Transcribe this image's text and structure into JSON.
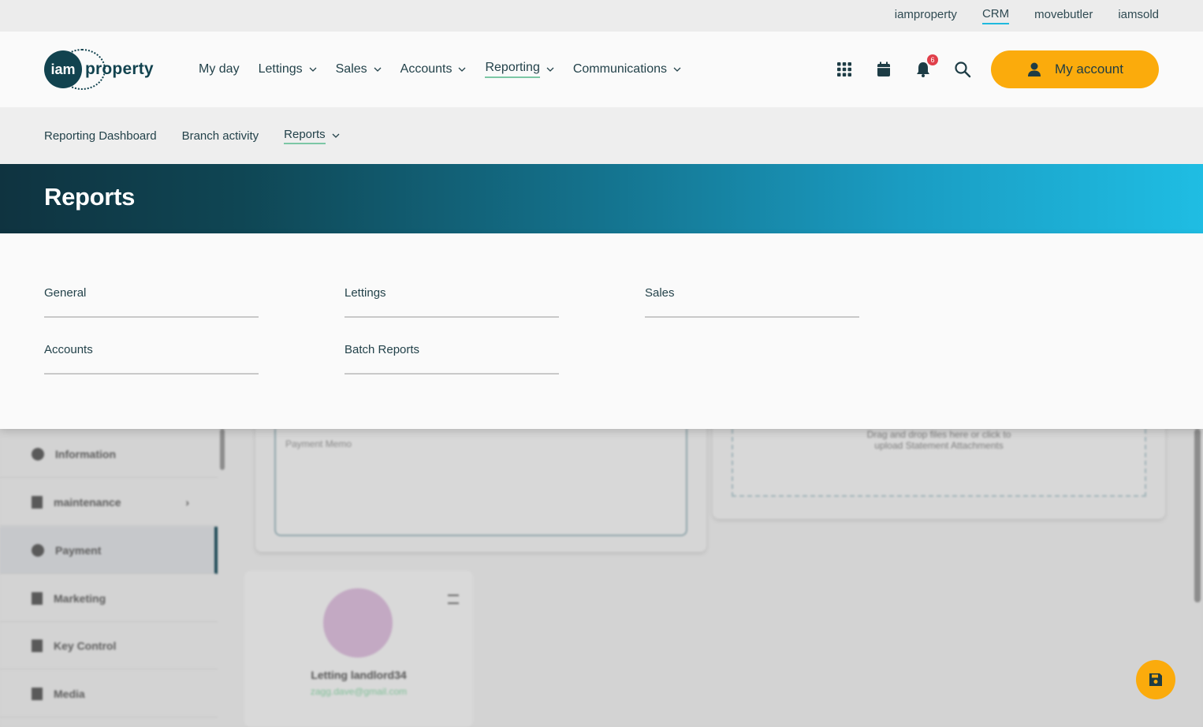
{
  "top_links": [
    "iamproperty",
    "CRM",
    "movebutler",
    "iamsold"
  ],
  "logo": {
    "circle_text": "iam",
    "word": "property"
  },
  "main_nav": [
    {
      "label": "My day",
      "has_menu": false
    },
    {
      "label": "Lettings",
      "has_menu": true
    },
    {
      "label": "Sales",
      "has_menu": true
    },
    {
      "label": "Accounts",
      "has_menu": true
    },
    {
      "label": "Reporting",
      "has_menu": true,
      "active": true
    },
    {
      "label": "Communications",
      "has_menu": true
    }
  ],
  "header_icons": {
    "apps": "grid-icon",
    "calendar": "calendar-icon",
    "notifications": "bell-icon",
    "notification_count": "6",
    "search": "search-icon"
  },
  "account": {
    "label": "My account",
    "icon": "user-icon"
  },
  "sub_nav": {
    "dashboard": "Reporting Dashboard",
    "branch": "Branch activity",
    "reports": "Reports"
  },
  "banner": {
    "title": "Reports"
  },
  "report_groups": {
    "general": "General",
    "lettings": "Lettings",
    "sales": "Sales",
    "accounts": "Accounts",
    "batch": "Batch Reports"
  },
  "background": {
    "side_items": {
      "information": "Information",
      "maintenance": "maintenance",
      "payment": "Payment",
      "marketing": "Marketing",
      "key_control": "Key Control",
      "media": "Media"
    },
    "memo_placeholder": "Payment Memo",
    "drop_text_1": "Drag and drop files here or click to",
    "drop_text_2": "upload Statement Attachments",
    "contact_name": "Letting landlord34",
    "contact_email": "zagg.dave@gmail.com"
  },
  "colors": {
    "accent": "#fbab0c",
    "brand_dark": "#12434f",
    "active_underline": "#7cc7a5",
    "crm_underline": "#1fb9de"
  }
}
